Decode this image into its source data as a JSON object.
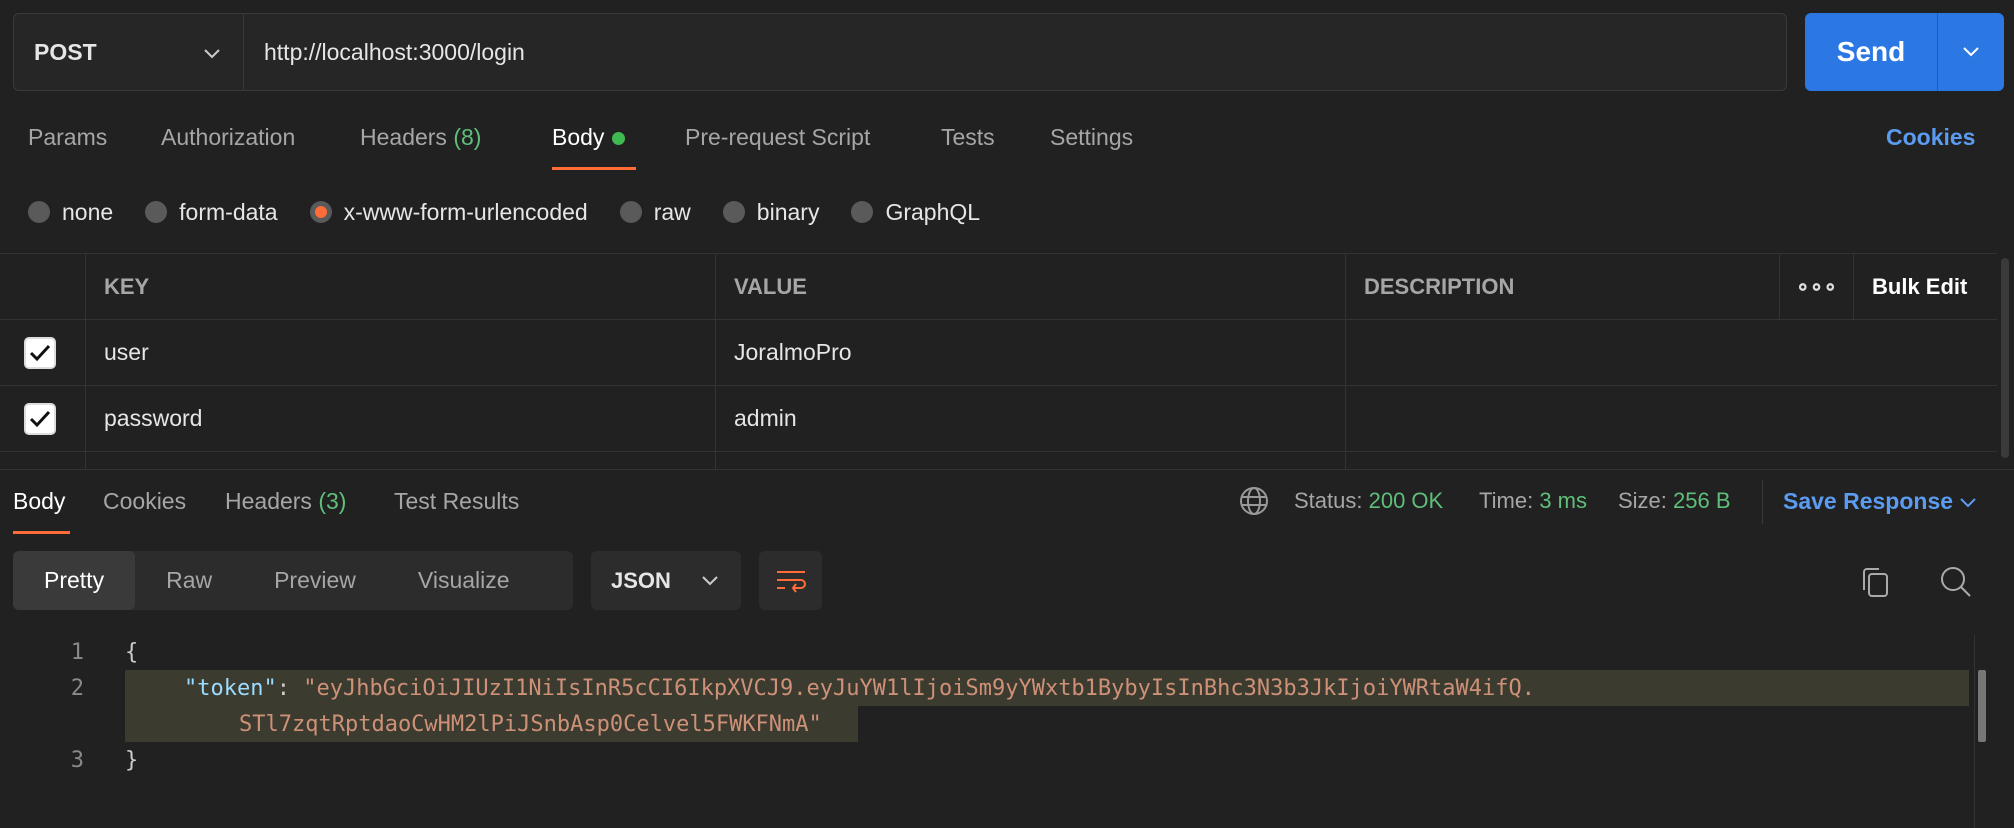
{
  "request": {
    "method": "POST",
    "url": "http://localhost:3000/login",
    "send_label": "Send"
  },
  "req_tabs": [
    {
      "label": "Params"
    },
    {
      "label": "Authorization"
    },
    {
      "label": "Headers",
      "count": "(8)"
    },
    {
      "label": "Body"
    },
    {
      "label": "Pre-request Script"
    },
    {
      "label": "Tests"
    },
    {
      "label": "Settings"
    }
  ],
  "cookies_link": "Cookies",
  "body_types": [
    "none",
    "form-data",
    "x-www-form-urlencoded",
    "raw",
    "binary",
    "GraphQL"
  ],
  "body_selected": "x-www-form-urlencoded",
  "table": {
    "headers": [
      "KEY",
      "VALUE",
      "DESCRIPTION"
    ],
    "bulk_edit": "Bulk Edit",
    "rows": [
      {
        "checked": true,
        "key": "user",
        "value": "JoralmoPro",
        "description": ""
      },
      {
        "checked": true,
        "key": "password",
        "value": "admin",
        "description": ""
      }
    ]
  },
  "resp_tabs": [
    {
      "label": "Body"
    },
    {
      "label": "Cookies"
    },
    {
      "label": "Headers",
      "count": "(3)"
    },
    {
      "label": "Test Results"
    }
  ],
  "status": {
    "status_label": "Status:",
    "status": "200 OK",
    "time_label": "Time:",
    "time": "3 ms",
    "size_label": "Size:",
    "size": "256 B",
    "save": "Save Response"
  },
  "view_modes": [
    "Pretty",
    "Raw",
    "Preview",
    "Visualize"
  ],
  "format": "JSON",
  "code": {
    "lines": [
      "1",
      "2",
      "3"
    ],
    "open": "{",
    "close": "}",
    "key": "\"token\"",
    "colon": ": ",
    "value_line1": "\"eyJhbGciOiJIUzI1NiIsInR5cCI6IkpXVCJ9.eyJuYW1lIjoiSm9yYWxtb1BybyIsInBhc3N3b3JkIjoiYWRtaW4ifQ.",
    "value_line2": "STl7zqtRptdaoCwHM2lPiJSnbAsp0Celvel5FWKFNmA\""
  },
  "colors": {
    "accent": "#ff6c37",
    "send": "#2b78e4",
    "ok": "#5fbf7a",
    "link": "#5b9bf0"
  }
}
